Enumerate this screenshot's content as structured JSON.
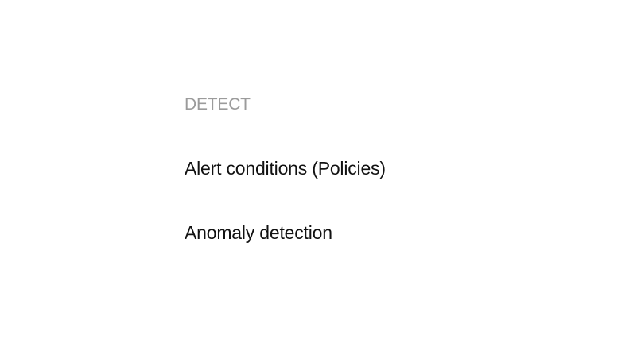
{
  "section": {
    "heading": "DETECT",
    "items": [
      {
        "label": "Alert conditions (Policies)"
      },
      {
        "label": "Anomaly detection"
      }
    ]
  },
  "colors": {
    "heading": "#9b9b9b",
    "item_text": "#111111",
    "background": "#ffffff"
  }
}
